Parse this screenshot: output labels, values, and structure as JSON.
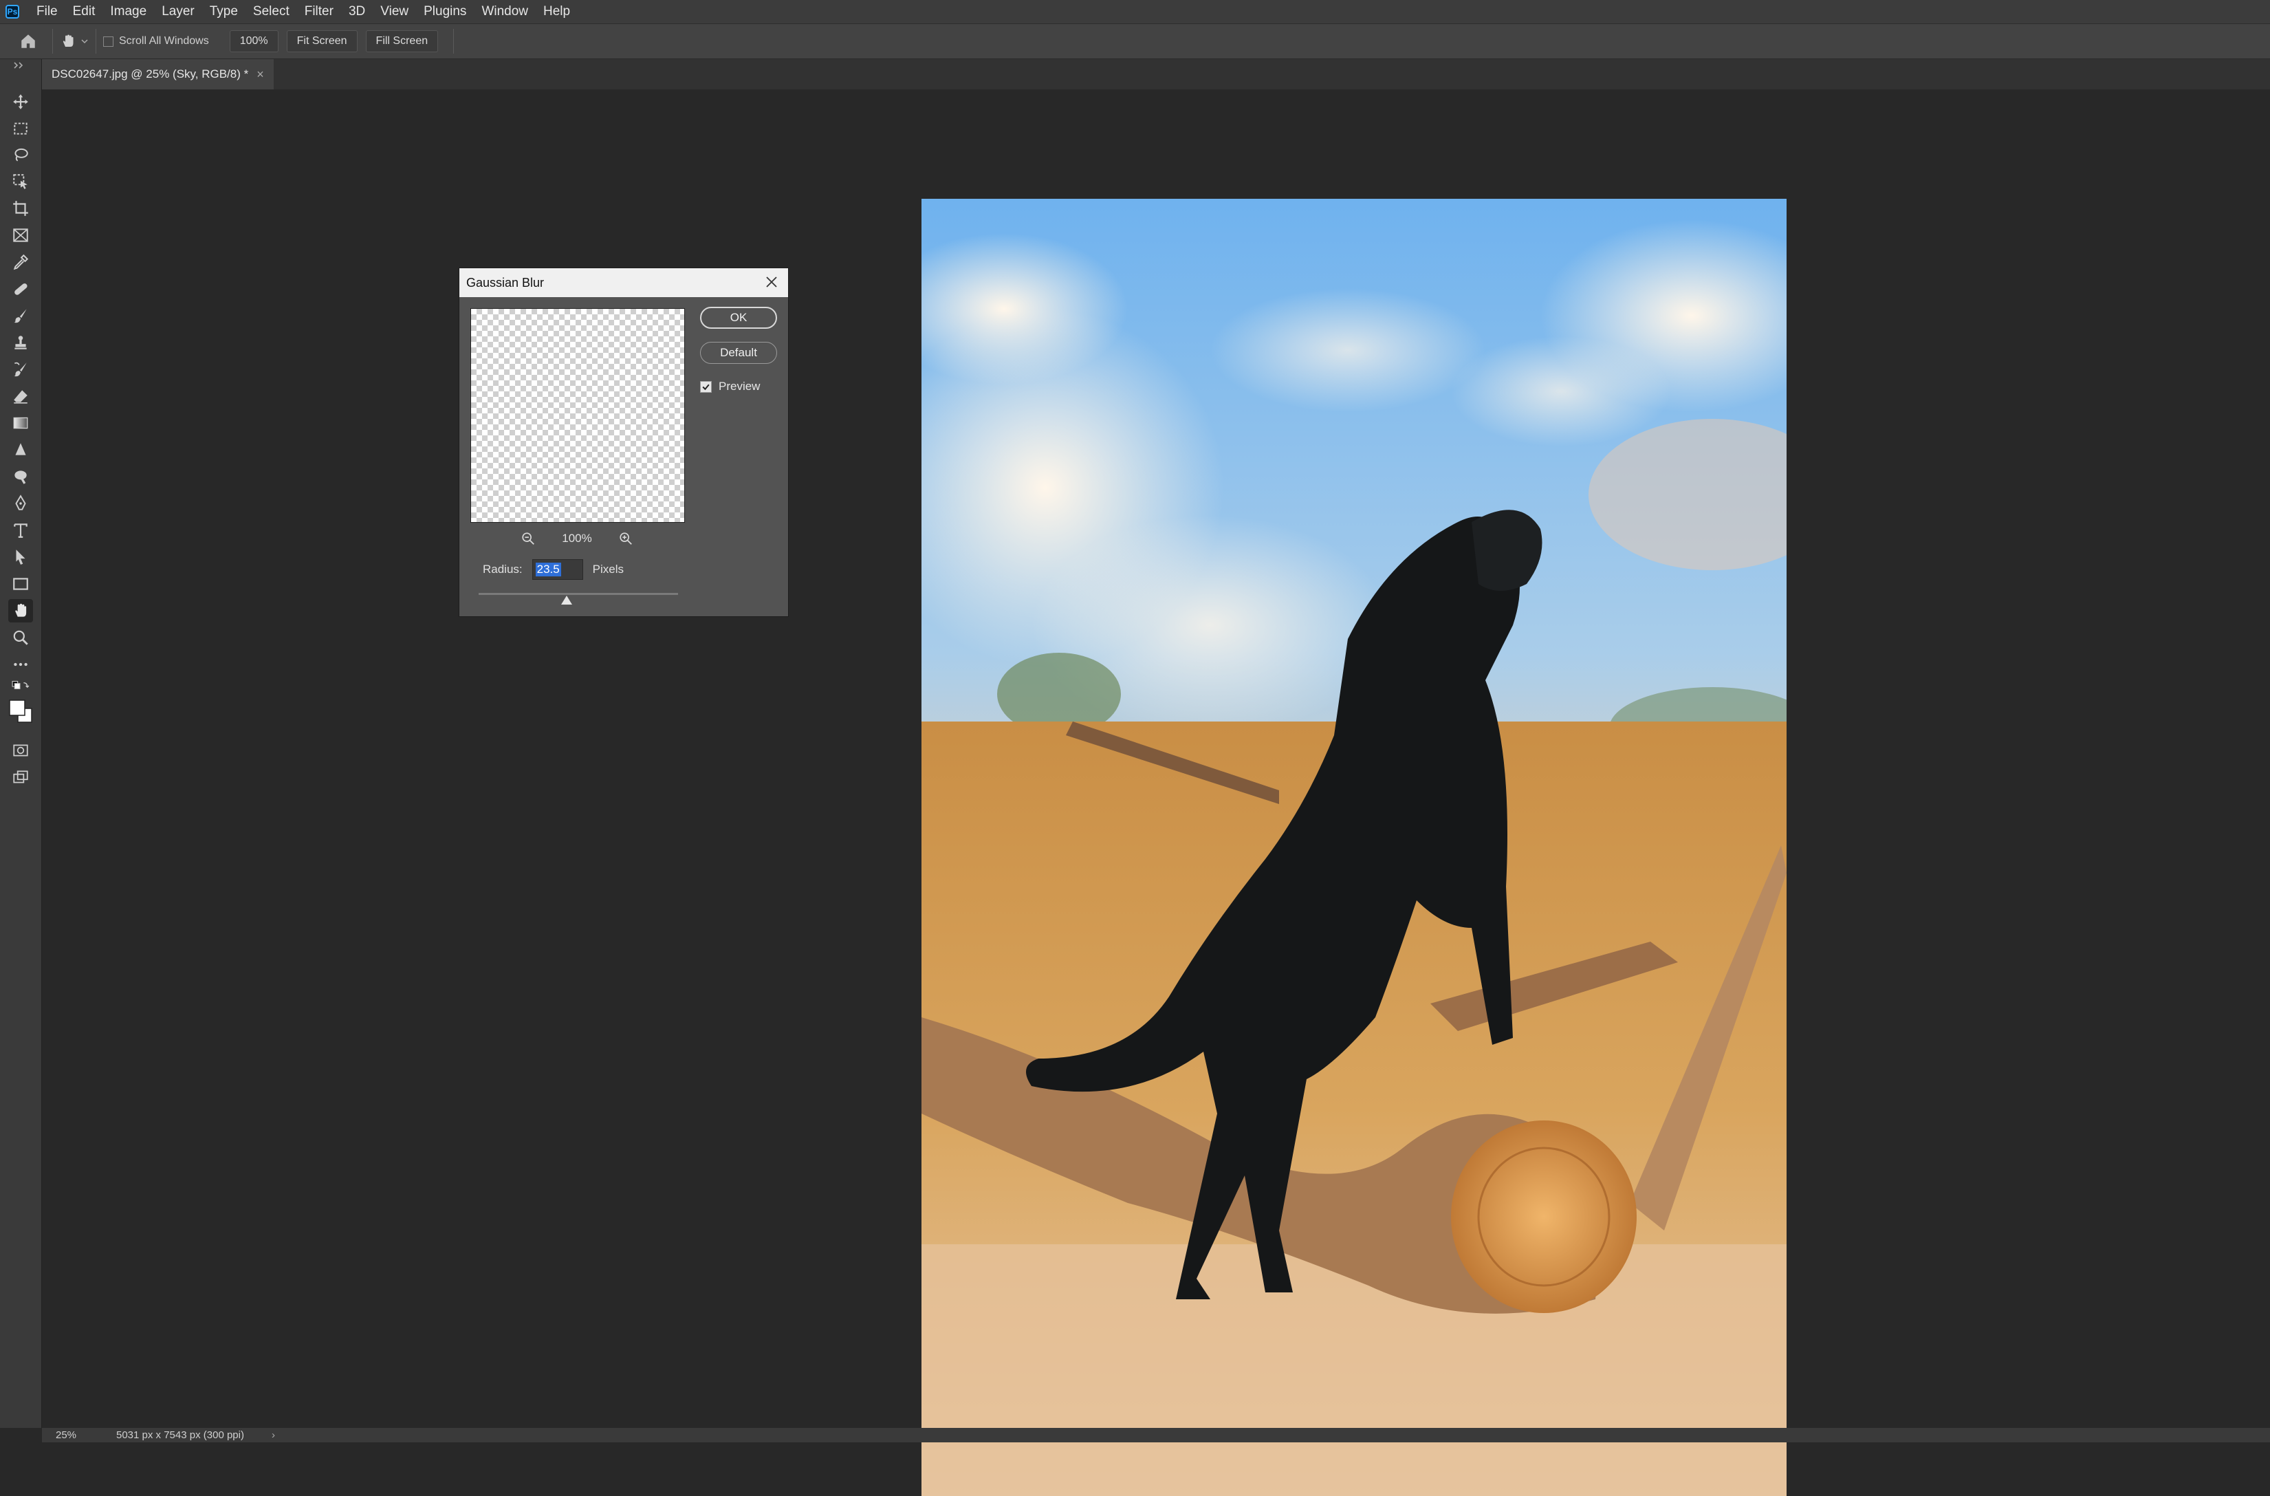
{
  "menu": {
    "logo": "Ps",
    "items": [
      "File",
      "Edit",
      "Image",
      "Layer",
      "Type",
      "Select",
      "Filter",
      "3D",
      "View",
      "Plugins",
      "Window",
      "Help"
    ]
  },
  "options": {
    "scroll_all_windows": "Scroll All Windows",
    "zoom_100": "100%",
    "fit_screen": "Fit Screen",
    "fill_screen": "Fill Screen"
  },
  "document": {
    "tab_title": "DSC02647.jpg @ 25% (Sky, RGB/8) *",
    "close": "×"
  },
  "dialog": {
    "title": "Gaussian Blur",
    "ok": "OK",
    "default": "Default",
    "preview_label": "Preview",
    "preview_checked": true,
    "preview_zoom": "100%",
    "radius_label": "Radius:",
    "radius_value": "23.5",
    "radius_unit": "Pixels"
  },
  "status": {
    "zoom": "25%",
    "info": "5031 px x 7543 px (300 ppi)",
    "arrow": "›"
  },
  "colors": {
    "accent": "#31a8ff",
    "selection": "#2f6fd8",
    "panel": "#535353",
    "canvas_bg": "#282828"
  }
}
